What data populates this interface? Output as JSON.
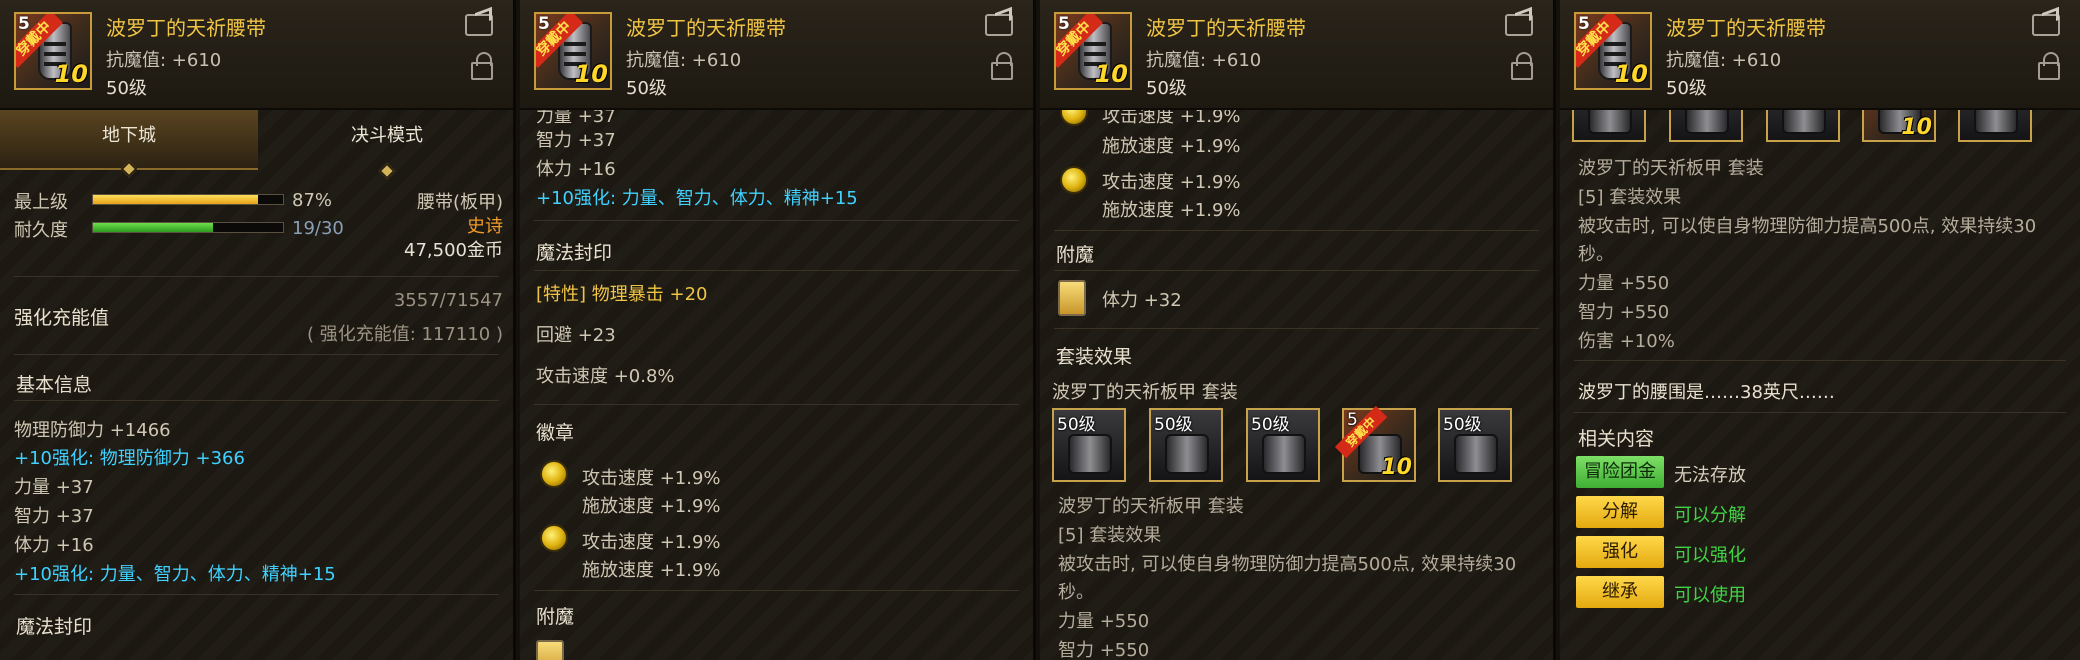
{
  "item": {
    "name": "波罗丁的天祈腰带",
    "resist": "抗魔值: +610",
    "level": "50级",
    "icon_level": "5",
    "icon_badge": "穿戴中",
    "icon_plus": "10"
  },
  "tabs": [
    "地下城",
    "决斗模式"
  ],
  "stats": {
    "max_level_label": "最上级",
    "max_level_value": "87%",
    "max_level_fraction": 0.87,
    "durability_label": "耐久度",
    "durability_value": "19/30",
    "durability_fraction": 0.633,
    "type": "腰带(板甲)",
    "rarity": "史诗",
    "price": "47,500金币"
  },
  "enhance_energy": {
    "label": "强化充能值",
    "value": "3557/71547",
    "sub": "( 强化充能值: 117110 )"
  },
  "basic_info": {
    "title": "基本信息",
    "lines": [
      "物理防御力 +1466",
      "+10强化: 物理防御力 +366",
      "力量 +37",
      "智力 +37",
      "体力 +16",
      "+10强化: 力量、智力、体力、精神+15"
    ]
  },
  "magic_seal": {
    "title": "魔法封印",
    "line1": "[特性] 物理暴击 +20",
    "line2": "回避 +23",
    "line3": "攻击速度 +0.8%"
  },
  "emblem": {
    "title": "徽章",
    "items": [
      {
        "a": "攻击速度 +1.9%",
        "b": "施放速度 +1.9%"
      },
      {
        "a": "攻击速度 +1.9%",
        "b": "施放速度 +1.9%"
      }
    ]
  },
  "enchant": {
    "title": "附魔",
    "value": "体力 +32"
  },
  "set": {
    "title": "套装效果",
    "name": "波罗丁的天祈板甲 套装",
    "slot_level": "50级",
    "set_line": "波罗丁的天祈板甲 套装",
    "count_line": "[5] 套装效果",
    "effect1": "被攻击时, 可以使自身物理防御力提高500点, 效果持续30",
    "effect2": "秒。",
    "bonus1": "力量 +550",
    "bonus2": "智力 +550",
    "bonus3": "伤害 +10%"
  },
  "flavor": "波罗丁的腰围是……38英尺……",
  "related": {
    "title": "相关内容",
    "rows": [
      {
        "button": "冒险团金库",
        "text": "无法存放"
      },
      {
        "button": "分解",
        "text": "可以分解"
      },
      {
        "button": "强化",
        "text": "可以强化"
      },
      {
        "button": "继承",
        "text": "可以使用"
      }
    ]
  },
  "clipped": {
    "p2_top": "力量 +37",
    "p2_bottom": "附魔",
    "p3_top": "攻击速度 +1.9%",
    "p3_bottom": "智力 +550"
  },
  "colors": {
    "title": "#f0c444",
    "cyan": "#3fd1ff",
    "orange": "#f09a28",
    "green": "#41d444"
  }
}
